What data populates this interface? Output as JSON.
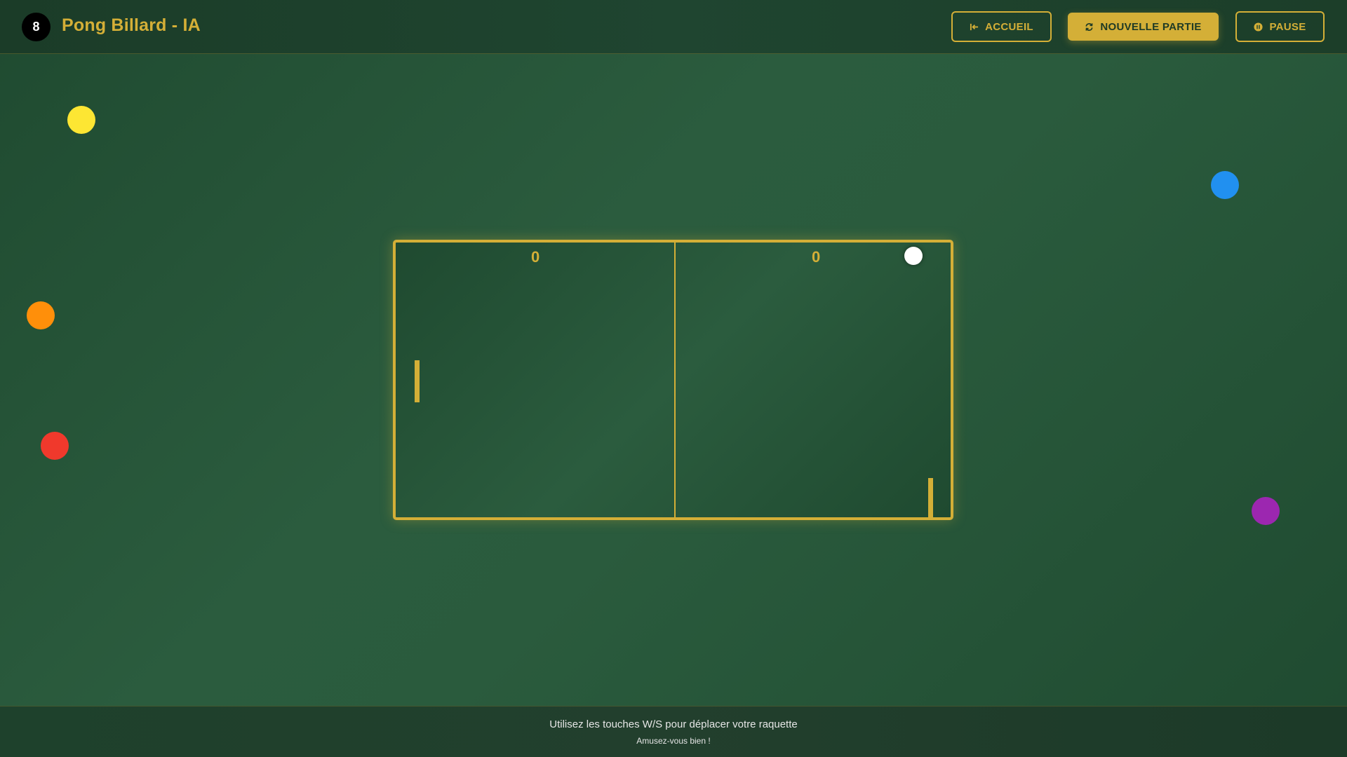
{
  "header": {
    "logo_number": "8",
    "title": "Pong Billard - IA",
    "buttons": {
      "home": {
        "label": "ACCUEIL",
        "icon": "exit-arrow-icon"
      },
      "new_game": {
        "label": "NOUVELLE PARTIE",
        "icon": "refresh-icon"
      },
      "pause": {
        "label": "PAUSE",
        "icon": "pause-icon"
      }
    }
  },
  "game": {
    "score_left": "0",
    "score_right": "0"
  },
  "decor_balls": [
    {
      "color": "#fde633"
    },
    {
      "color": "#ff8f0a"
    },
    {
      "color": "#f0392c"
    },
    {
      "color": "#2190f0"
    },
    {
      "color": "#9c27b0"
    }
  ],
  "colors": {
    "accent": "#d4af37",
    "felt": "#2b5c3e"
  },
  "footer": {
    "instructions": "Utilisez les touches W/S pour déplacer votre raquette",
    "message": "Amusez-vous bien !"
  }
}
